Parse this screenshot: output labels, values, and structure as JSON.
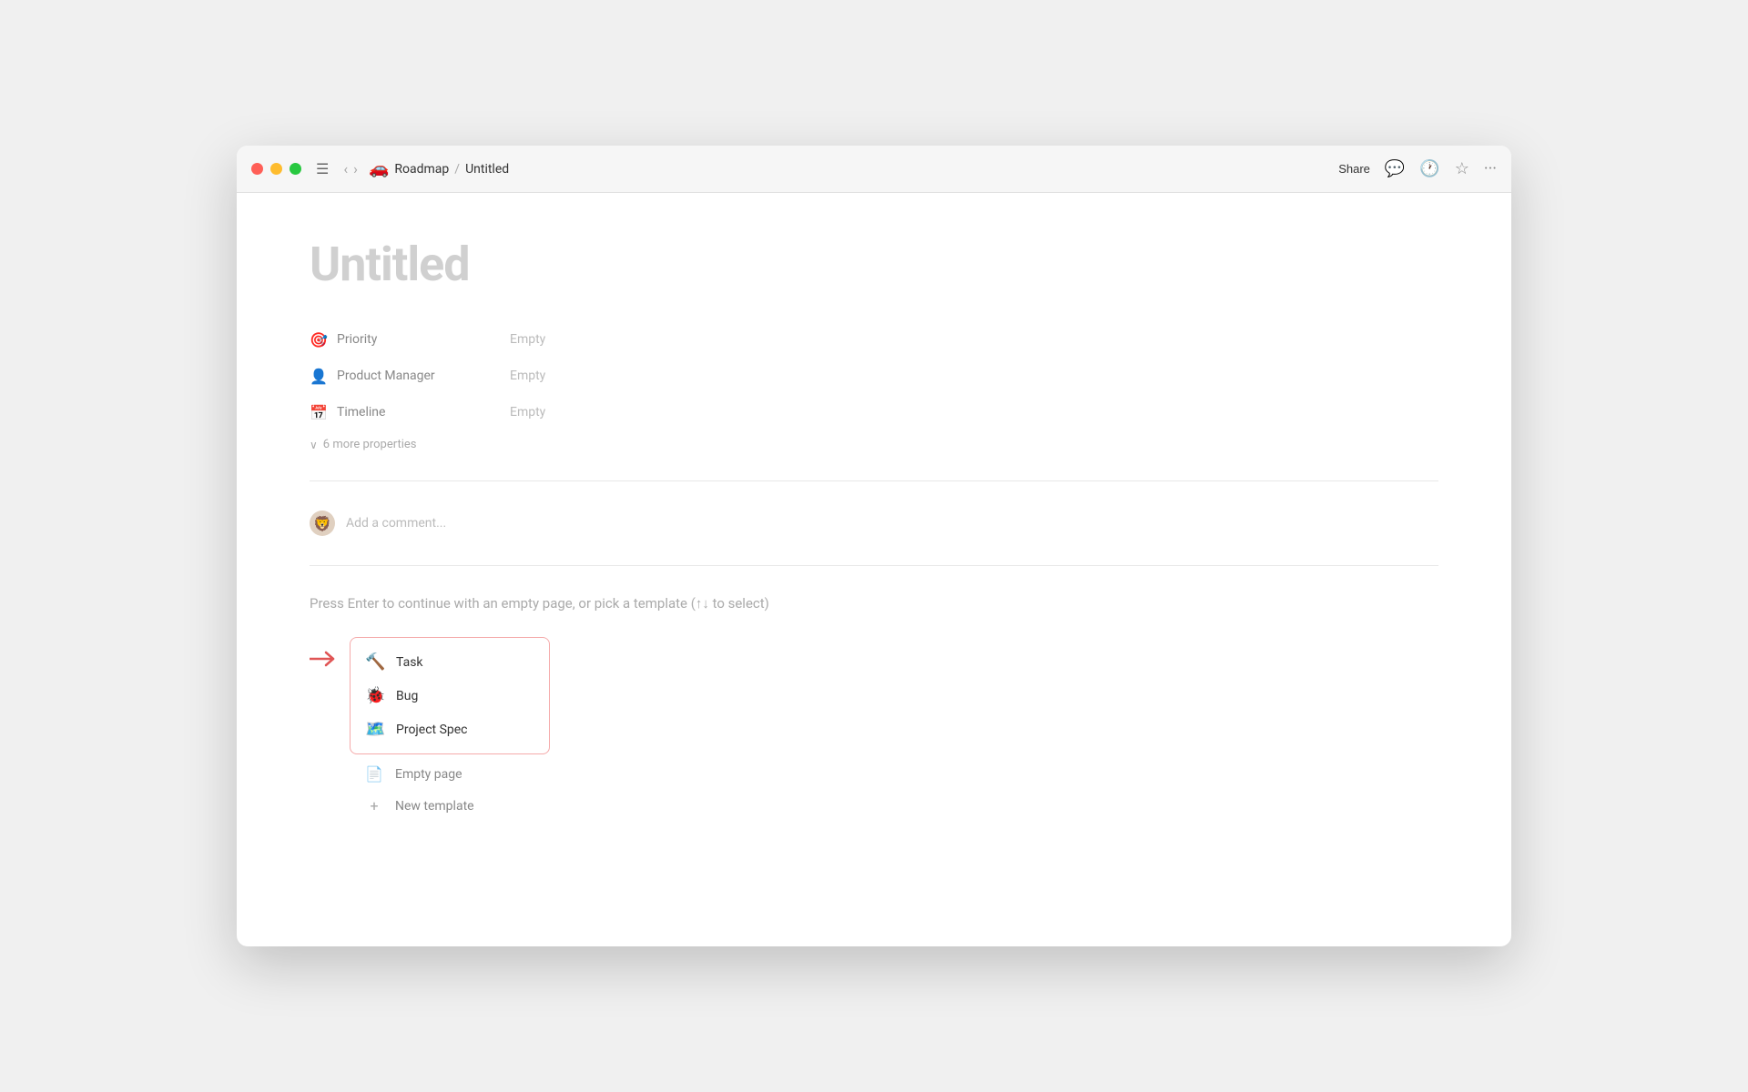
{
  "window": {
    "title": "Untitled"
  },
  "titlebar": {
    "breadcrumb": {
      "emoji": "🚗",
      "parent": "Roadmap",
      "separator": "/",
      "current": "Untitled"
    },
    "share_label": "Share",
    "actions": {
      "comment_icon": "💬",
      "history_icon": "🕐",
      "favorite_icon": "☆",
      "more_icon": "•••"
    }
  },
  "page": {
    "title": "Untitled",
    "properties": [
      {
        "icon": "🎯",
        "label": "Priority",
        "value": "Empty"
      },
      {
        "icon": "👤",
        "label": "Product Manager",
        "value": "Empty"
      },
      {
        "icon": "📅",
        "label": "Timeline",
        "value": "Empty"
      }
    ],
    "more_properties_label": "6 more properties",
    "comment_placeholder": "Add a comment...",
    "comment_avatar": "🦁",
    "template_prompt": "Press Enter to continue with an empty page, or pick a template (↑↓ to select)",
    "templates": [
      {
        "icon": "🔨",
        "label": "Task"
      },
      {
        "icon": "🐞",
        "label": "Bug"
      },
      {
        "icon": "🗺️",
        "label": "Project Spec"
      }
    ],
    "extra_items": [
      {
        "icon": "📄",
        "label": "Empty page"
      },
      {
        "icon": "+",
        "label": "New template"
      }
    ]
  }
}
